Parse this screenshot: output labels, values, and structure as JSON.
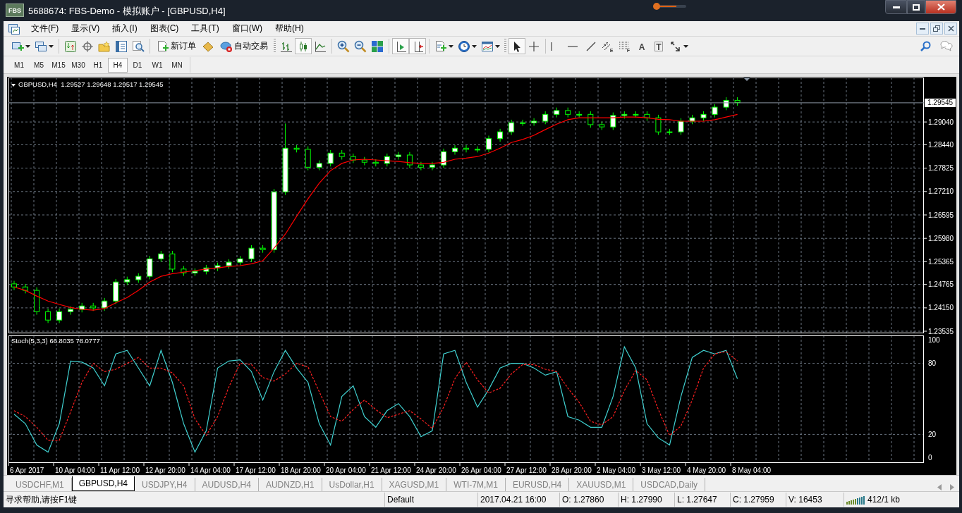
{
  "window": {
    "logo": "FBS",
    "title": "5688674: FBS-Demo - 模拟账户 - [GBPUSD,H4]"
  },
  "menu": [
    "文件(F)",
    "显示(V)",
    "插入(I)",
    "图表(C)",
    "工具(T)",
    "窗口(W)",
    "帮助(H)"
  ],
  "toolbar": {
    "labeled_buttons": [
      {
        "label": "新订单"
      },
      {
        "label": "自动交易"
      }
    ],
    "chart_type_buttons": [
      {
        "selected": false
      },
      {
        "selected": true
      },
      {
        "selected": false
      }
    ],
    "chart_shift_buttons": [
      {
        "selected": true
      },
      {
        "selected": true
      }
    ],
    "drawing_tools": [
      {
        "selected": true
      },
      {
        "selected": false
      },
      {
        "selected": false
      },
      {
        "selected": false
      },
      {
        "selected": false
      },
      {
        "selected": false,
        "letter": "E"
      },
      {
        "selected": false,
        "letter": "F"
      },
      {
        "selected": false,
        "letter": "A"
      },
      {
        "selected": false,
        "letter": "T"
      },
      {
        "selected": false
      }
    ]
  },
  "timeframes": [
    {
      "label": "M1",
      "selected": false
    },
    {
      "label": "M5",
      "selected": false
    },
    {
      "label": "M15",
      "selected": false
    },
    {
      "label": "M30",
      "selected": false
    },
    {
      "label": "H1",
      "selected": false
    },
    {
      "label": "H4",
      "selected": true
    },
    {
      "label": "D1",
      "selected": false
    },
    {
      "label": "W1",
      "selected": false
    },
    {
      "label": "MN",
      "selected": false
    }
  ],
  "price_chart": {
    "header": "GBPUSD,H4  1.29527 1.29648 1.29517 1.29545",
    "chart_data": {
      "type": "candlestick",
      "grid": true,
      "ylim": [
        1.2348,
        1.3021
      ],
      "categories": [
        null,
        null,
        null,
        null,
        null,
        null,
        null,
        null,
        null,
        null,
        null,
        null,
        null,
        null,
        null,
        null,
        null,
        null,
        null,
        null,
        null,
        null,
        null,
        null,
        null,
        null,
        null,
        null,
        null,
        null,
        null,
        null,
        null,
        null,
        null,
        null,
        null,
        null,
        null,
        null,
        null,
        null,
        null,
        null,
        null,
        null,
        null,
        null,
        null,
        null,
        null,
        null,
        null,
        null,
        null,
        null,
        null,
        null,
        null,
        null,
        null,
        null,
        null,
        null,
        null,
        null,
        null,
        null,
        null,
        null,
        null,
        null,
        null,
        null,
        null,
        null,
        null,
        null,
        null,
        null,
        null
      ],
      "yticks": [
        {
          "value": 1.2904,
          "label": "1.29040"
        },
        {
          "value": 1.2844,
          "label": "1.28440"
        },
        {
          "value": 1.27825,
          "label": "1.27825"
        },
        {
          "value": 1.2721,
          "label": "1.27210"
        },
        {
          "value": 1.26595,
          "label": "1.26595"
        },
        {
          "value": 1.2598,
          "label": "1.25980"
        },
        {
          "value": 1.25365,
          "label": "1.25365"
        },
        {
          "value": 1.24765,
          "label": "1.24765"
        },
        {
          "value": 1.2415,
          "label": "1.24150"
        },
        {
          "value": 1.23535,
          "label": "1.23535"
        }
      ],
      "ohlc": [
        [
          1.2478,
          1.2486,
          1.2462,
          1.247
        ],
        [
          1.247,
          1.2478,
          1.2453,
          1.2461
        ],
        [
          1.2461,
          1.2469,
          1.2397,
          1.2405
        ],
        [
          1.2405,
          1.2413,
          1.2375,
          1.2383
        ],
        [
          1.2383,
          1.2413,
          1.2375,
          1.2405
        ],
        [
          1.2405,
          1.2419,
          1.2397,
          1.2411
        ],
        [
          1.2411,
          1.2428,
          1.2403,
          1.242
        ],
        [
          1.242,
          1.2428,
          1.2407,
          1.2415
        ],
        [
          1.2415,
          1.2441,
          1.2407,
          1.2433
        ],
        [
          1.2433,
          1.2491,
          1.2425,
          1.2483
        ],
        [
          1.2483,
          1.2497,
          1.2475,
          1.2489
        ],
        [
          1.2489,
          1.2506,
          1.2481,
          1.2498
        ],
        [
          1.2498,
          1.2552,
          1.249,
          1.2544
        ],
        [
          1.2544,
          1.2565,
          1.2536,
          1.2557
        ],
        [
          1.2557,
          1.2565,
          1.2509,
          1.2517
        ],
        [
          1.2517,
          1.2525,
          1.2499,
          1.2507
        ],
        [
          1.2507,
          1.2519,
          1.2499,
          1.2511
        ],
        [
          1.2511,
          1.2528,
          1.2503,
          1.252
        ],
        [
          1.252,
          1.2534,
          1.2512,
          1.2526
        ],
        [
          1.2526,
          1.2543,
          1.2518,
          1.2535
        ],
        [
          1.2535,
          1.2552,
          1.2527,
          1.2544
        ],
        [
          1.2544,
          1.258,
          1.2536,
          1.2572
        ],
        [
          1.2572,
          1.258,
          1.256,
          1.2568
        ],
        [
          1.2568,
          1.2728,
          1.256,
          1.272
        ],
        [
          1.272,
          1.29,
          1.2712,
          1.2835
        ],
        [
          1.2835,
          1.2843,
          1.2824,
          1.2832
        ],
        [
          1.2832,
          1.284,
          1.2777,
          1.2785
        ],
        [
          1.2785,
          1.2803,
          1.2777,
          1.2795
        ],
        [
          1.2795,
          1.283,
          1.2787,
          1.2822
        ],
        [
          1.2822,
          1.283,
          1.2805,
          1.2813
        ],
        [
          1.2813,
          1.2821,
          1.2796,
          1.2804
        ],
        [
          1.2804,
          1.2812,
          1.279,
          1.2798
        ],
        [
          1.2798,
          1.2806,
          1.2787,
          1.2795
        ],
        [
          1.2795,
          1.2821,
          1.2787,
          1.2813
        ],
        [
          1.2813,
          1.2825,
          1.2805,
          1.2817
        ],
        [
          1.2817,
          1.2825,
          1.2783,
          1.2791
        ],
        [
          1.2791,
          1.2799,
          1.2777,
          1.2785
        ],
        [
          1.2785,
          1.2799,
          1.2777,
          1.2791
        ],
        [
          1.2791,
          1.2834,
          1.2783,
          1.2826
        ],
        [
          1.2826,
          1.2843,
          1.2818,
          1.2835
        ],
        [
          1.2835,
          1.2843,
          1.2824,
          1.2832
        ],
        [
          1.2832,
          1.284,
          1.2824,
          1.2832
        ],
        [
          1.2832,
          1.2868,
          1.2824,
          1.286
        ],
        [
          1.286,
          1.2886,
          1.2852,
          1.2878
        ],
        [
          1.2878,
          1.291,
          1.287,
          1.2902
        ],
        [
          1.2902,
          1.291,
          1.2894,
          1.2902
        ],
        [
          1.2902,
          1.2914,
          1.2894,
          1.2906
        ],
        [
          1.2906,
          1.2932,
          1.2898,
          1.2924
        ],
        [
          1.2924,
          1.2942,
          1.2916,
          1.2934
        ],
        [
          1.2934,
          1.2942,
          1.2916,
          1.2924
        ],
        [
          1.2924,
          1.2932,
          1.2916,
          1.2924
        ],
        [
          1.2924,
          1.2932,
          1.2889,
          1.2897
        ],
        [
          1.2897,
          1.2905,
          1.2883,
          1.2891
        ],
        [
          1.2891,
          1.2929,
          1.2883,
          1.2921
        ],
        [
          1.2921,
          1.2932,
          1.2913,
          1.2924
        ],
        [
          1.2924,
          1.2932,
          1.2916,
          1.2924
        ],
        [
          1.2924,
          1.2932,
          1.2907,
          1.2915
        ],
        [
          1.2915,
          1.2923,
          1.287,
          1.2878
        ],
        [
          1.2878,
          1.2886,
          1.287,
          1.2878
        ],
        [
          1.2878,
          1.2914,
          1.287,
          1.2906
        ],
        [
          1.2906,
          1.2923,
          1.2898,
          1.2915
        ],
        [
          1.2915,
          1.2932,
          1.2907,
          1.2924
        ],
        [
          1.2924,
          1.2951,
          1.2916,
          1.2943
        ],
        [
          1.2943,
          1.2969,
          1.2935,
          1.2961
        ],
        [
          1.2961,
          1.2969,
          1.2947,
          1.2955
        ],
        null,
        null,
        null,
        null,
        null,
        null,
        null,
        null,
        null,
        null,
        null,
        null,
        null,
        null,
        null,
        null
      ],
      "series": [
        {
          "type": "line",
          "color": "#ff0000",
          "values": [
            1.247,
            1.2461,
            1.2446,
            1.2433,
            1.2424,
            1.2416,
            1.2411,
            1.2409,
            1.2413,
            1.2428,
            1.2442,
            1.2461,
            1.2483,
            1.2498,
            1.2505,
            1.2509,
            1.2513,
            1.2517,
            1.252,
            1.2524,
            1.2526,
            1.2531,
            1.2539,
            1.2572,
            1.2609,
            1.2656,
            1.2702,
            1.2743,
            1.2776,
            1.2795,
            1.2804,
            1.2806,
            1.2804,
            1.2802,
            1.28,
            1.2797,
            1.2795,
            1.2795,
            1.2798,
            1.2806,
            1.2809,
            1.2813,
            1.2822,
            1.2835,
            1.285,
            1.2858,
            1.2869,
            1.2884,
            1.2898,
            1.291,
            1.2915,
            1.2915,
            1.2915,
            1.2915,
            1.2917,
            1.2917,
            1.2915,
            1.2911,
            1.291,
            1.2906,
            1.2906,
            1.2906,
            1.291,
            1.2917,
            1.2924,
            null,
            null,
            null,
            null,
            null,
            null,
            null,
            null,
            null,
            null,
            null,
            null,
            null,
            null,
            null,
            null
          ]
        }
      ],
      "ref_lines": [
        {
          "axis": "y",
          "value": 1.29545,
          "label": "1.29545",
          "color": "#8a96a4"
        }
      ]
    }
  },
  "stochastic_chart": {
    "header": "Stoch(5,3,3) 66.8035 78.0777",
    "chart_data": {
      "type": "line",
      "grid": true,
      "ylim": [
        -4.2,
        103.6
      ],
      "categories": [
        null,
        null,
        null,
        null,
        null,
        null,
        null,
        null,
        null,
        null,
        null,
        null,
        null,
        null,
        null,
        null,
        null,
        null,
        null,
        null,
        null,
        null,
        null,
        null,
        null,
        null,
        null,
        null,
        null,
        null,
        null,
        null,
        null,
        null,
        null,
        null,
        null,
        null,
        null,
        null,
        null,
        null,
        null,
        null,
        null,
        null,
        null,
        null,
        null,
        null,
        null,
        null,
        null,
        null,
        null,
        null,
        null,
        null,
        null,
        null,
        null,
        null,
        null,
        null,
        null,
        null,
        null,
        null,
        null,
        null,
        null,
        null,
        null,
        null,
        null,
        null,
        null,
        null,
        null,
        null,
        null
      ],
      "yticks": [
        100,
        80,
        20,
        0
      ],
      "series": [
        {
          "color": "#40d0d0",
          "values": [
            37,
            29,
            11,
            5,
            29,
            82,
            81,
            76,
            61,
            88,
            91,
            76,
            61,
            91,
            64,
            29,
            5,
            23,
            76,
            82,
            83,
            73,
            49,
            73,
            91,
            76,
            64,
            29,
            11,
            52,
            61,
            35,
            26,
            40,
            46,
            35,
            18,
            23,
            88,
            91,
            64,
            43,
            58,
            76,
            80,
            80,
            76,
            70,
            73,
            35,
            32,
            26,
            26,
            52,
            94,
            76,
            29,
            17,
            11,
            52,
            85,
            91,
            88,
            91,
            67,
            null,
            null,
            null,
            null,
            null,
            null,
            null,
            null,
            null,
            null,
            null,
            null,
            null,
            null,
            null,
            null
          ]
        },
        {
          "color": "#ff2020",
          "line_style": "dashed",
          "values": [
            40,
            35,
            26,
            15,
            15,
            39,
            64,
            80,
            73,
            75,
            80,
            85,
            76,
            76,
            72,
            61,
            33,
            19,
            35,
            60,
            80,
            79,
            68,
            65,
            71,
            80,
            77,
            56,
            35,
            31,
            41,
            49,
            41,
            34,
            37,
            40,
            33,
            25,
            43,
            67,
            81,
            66,
            55,
            59,
            71,
            79,
            79,
            75,
            73,
            59,
            47,
            31,
            28,
            35,
            57,
            74,
            66,
            41,
            19,
            27,
            49,
            76,
            88,
            90,
            82,
            null,
            null,
            null,
            null,
            null,
            null,
            null,
            null,
            null,
            null,
            null,
            null,
            null,
            null,
            null,
            null
          ]
        }
      ]
    },
    "time_axis": [
      "6 Apr 2017",
      "10 Apr 04:00",
      "11 Apr 12:00",
      "12 Apr 20:00",
      "14 Apr 04:00",
      "17 Apr 12:00",
      "18 Apr 20:00",
      "20 Apr 04:00",
      "21 Apr 12:00",
      "24 Apr 20:00",
      "26 Apr 04:00",
      "27 Apr 12:00",
      "28 Apr 20:00",
      "2 May 04:00",
      "3 May 12:00",
      "4 May 20:00",
      "8 May 04:00"
    ]
  },
  "tabs": [
    {
      "label": "USDCHF,M1",
      "selected": false
    },
    {
      "label": "GBPUSD,H4",
      "selected": true
    },
    {
      "label": "USDJPY,H4",
      "selected": false
    },
    {
      "label": "AUDUSD,H4",
      "selected": false
    },
    {
      "label": "AUDNZD,H1",
      "selected": false
    },
    {
      "label": "UsDollar,H1",
      "selected": false
    },
    {
      "label": "XAGUSD,M1",
      "selected": false
    },
    {
      "label": "WTI-7M,M1",
      "selected": false
    },
    {
      "label": "EURUSD,H4",
      "selected": false
    },
    {
      "label": "XAUUSD,M1",
      "selected": false
    },
    {
      "label": "USDCAD,Daily",
      "selected": false
    }
  ],
  "status_bar": {
    "help": "寻求帮助,请按F1键",
    "profile": "Default",
    "time": "2017.04.21 16:00",
    "open": "O: 1.27860",
    "high": "H: 1.27990",
    "low": "L: 1.27647",
    "close": "C: 1.27959",
    "volume": "V: 16453",
    "traffic": "412/1 kb"
  }
}
